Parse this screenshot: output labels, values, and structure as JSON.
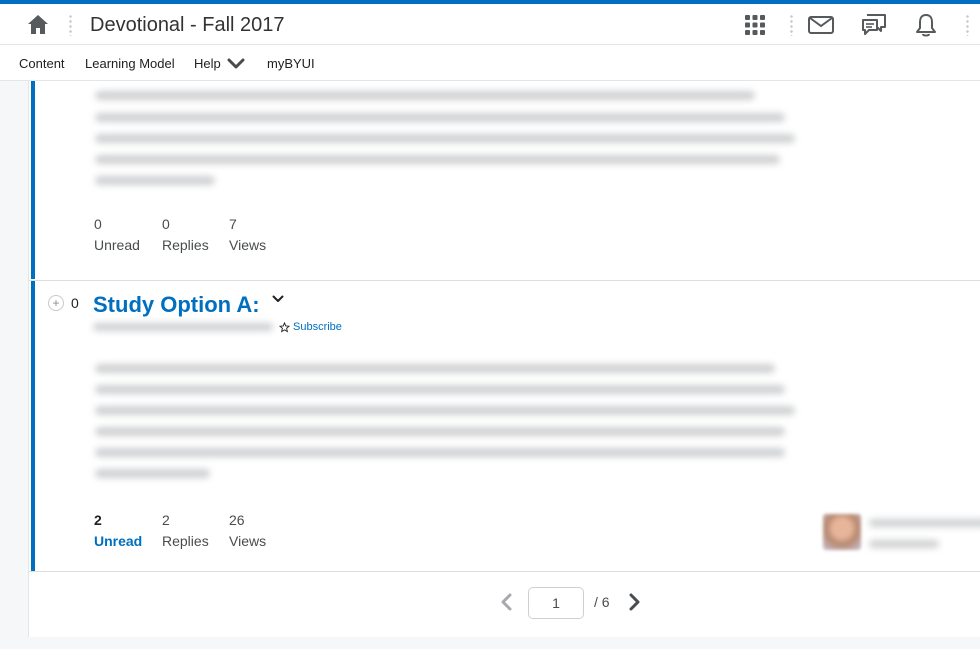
{
  "header": {
    "course_title": "Devotional - Fall 2017",
    "icons": [
      "home-icon",
      "apps-grid-icon",
      "mail-icon",
      "chat-icon",
      "bell-icon"
    ]
  },
  "nav": {
    "items": [
      {
        "label": "Content"
      },
      {
        "label": "Learning Model"
      },
      {
        "label": "Help"
      },
      {
        "label": "myBYUI"
      }
    ]
  },
  "topics": [
    {
      "unread_count": "0",
      "unread_label": "Unread",
      "replies_count": "0",
      "replies_label": "Replies",
      "views_count": "7",
      "views_label": "Views"
    },
    {
      "rating": "0",
      "title": "Study Option A:",
      "subscribe_label": "Subscribe",
      "unread_count": "2",
      "unread_label": "Unread",
      "replies_count": "2",
      "replies_label": "Replies",
      "views_count": "26",
      "views_label": "Views"
    }
  ],
  "pagination": {
    "current_page": "1",
    "total_label": "/ 6"
  },
  "colors": {
    "accent": "#006fbf",
    "text": "#494c4e"
  }
}
